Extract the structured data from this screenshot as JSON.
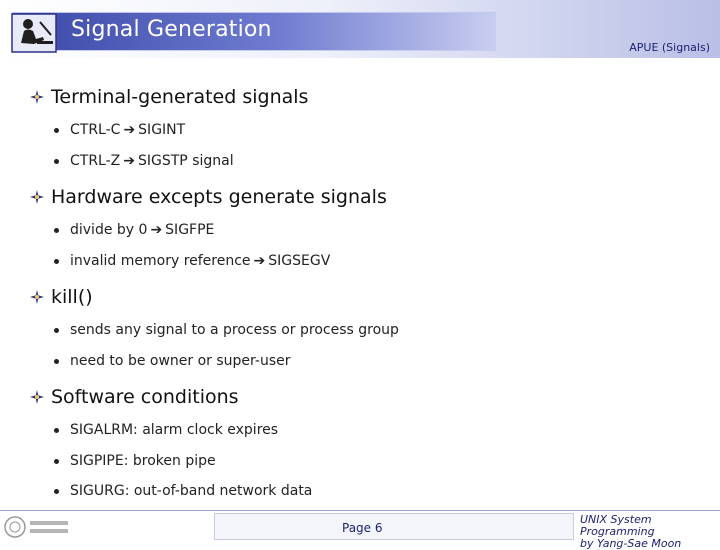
{
  "header": {
    "title": "Signal Generation",
    "subtitle": "APUE (Signals)"
  },
  "sections": [
    {
      "heading": "Terminal-generated signals",
      "items": [
        {
          "left": "CTRL-C",
          "right": "SIGINT"
        },
        {
          "left": "CTRL-Z",
          "right": "SIGSTP signal"
        }
      ]
    },
    {
      "heading": "Hardware excepts generate signals",
      "items": [
        {
          "left": "divide by 0",
          "right": "SIGFPE"
        },
        {
          "left": "invalid memory reference",
          "right": "SIGSEGV"
        }
      ]
    },
    {
      "heading": "kill()",
      "items": [
        {
          "text": "sends any signal to a process or process group"
        },
        {
          "text": "need to be owner or super-user"
        }
      ]
    },
    {
      "heading": "Software conditions",
      "items": [
        {
          "text": "SIGALRM: alarm clock expires"
        },
        {
          "text": "SIGPIPE: broken pipe"
        },
        {
          "text": "SIGURG: out-of-band network data"
        }
      ]
    }
  ],
  "footer": {
    "page": "Page 6",
    "course_line1": "UNIX System Programming",
    "course_line2": "by Yang-Sae Moon"
  },
  "colors": {
    "title_band": "#3a47a6",
    "accent_text": "#1b2370"
  }
}
